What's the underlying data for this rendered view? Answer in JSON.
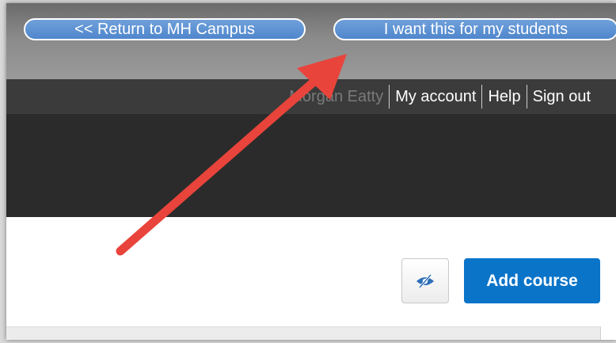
{
  "top_bar": {
    "return_label": "<<  Return to MH Campus",
    "want_label": "I want this for my students"
  },
  "account_nav": {
    "user_name": "Morgan Eatty",
    "my_account": "My account",
    "help": "Help",
    "sign_out": "Sign out"
  },
  "content": {
    "visibility_icon": "eye-slash-icon",
    "add_course_label": "Add course"
  },
  "annotation": {
    "type": "arrow",
    "color": "#e8443b",
    "points_to": "I want this for my students"
  },
  "colors": {
    "button_blue": "#0a74c9",
    "pill_blue": "#5b8fd1",
    "header_dark": "#2b2b2b"
  }
}
